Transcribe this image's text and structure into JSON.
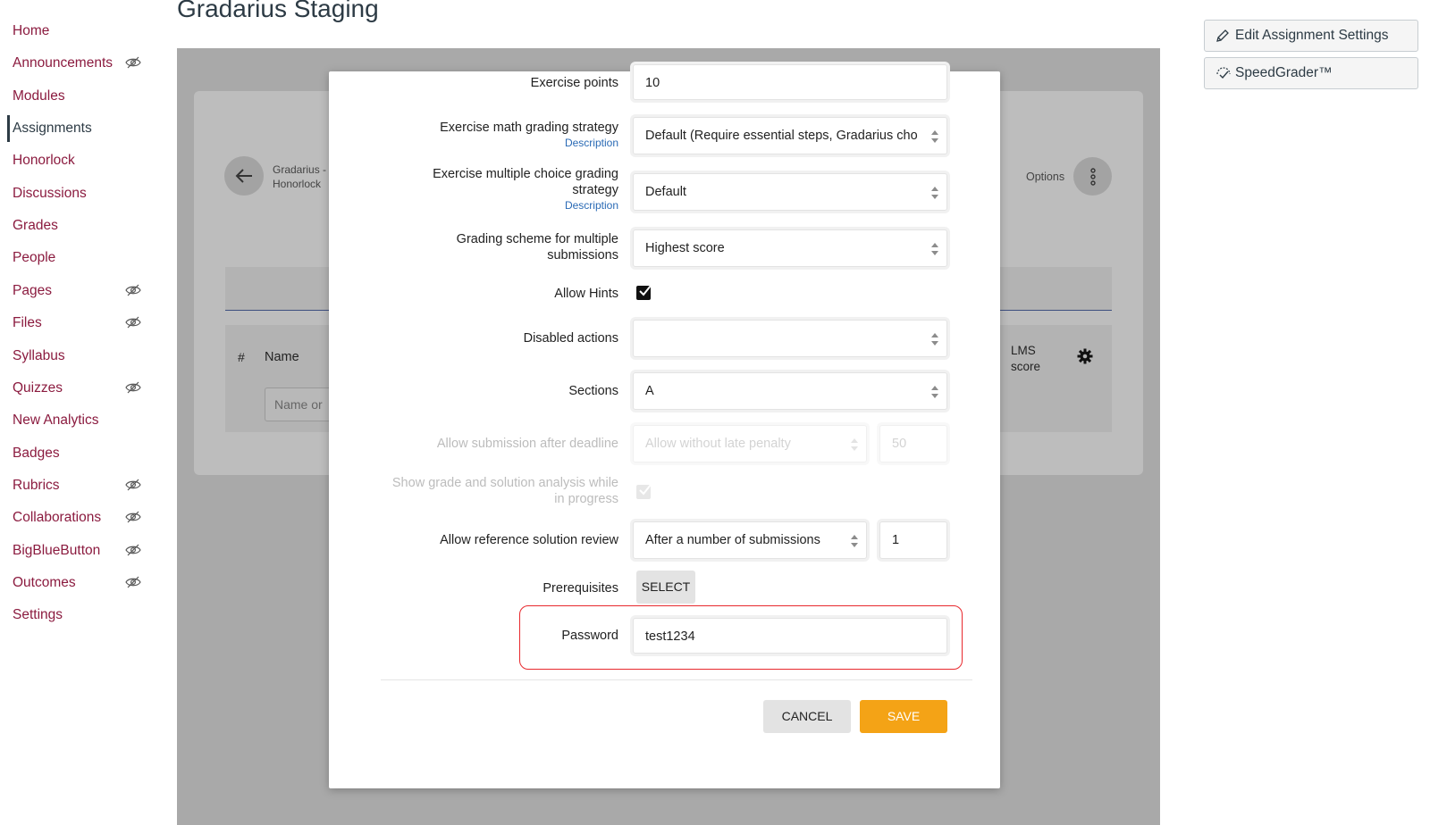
{
  "page_title": "Gradarius Staging",
  "course_nav": [
    {
      "label": "Home",
      "hidden": false
    },
    {
      "label": "Announcements",
      "hidden": true
    },
    {
      "label": "Modules",
      "hidden": false
    },
    {
      "label": "Assignments",
      "hidden": false,
      "active": true
    },
    {
      "label": "Honorlock",
      "hidden": false
    },
    {
      "label": "Discussions",
      "hidden": false
    },
    {
      "label": "Grades",
      "hidden": false
    },
    {
      "label": "People",
      "hidden": false
    },
    {
      "label": "Pages",
      "hidden": true
    },
    {
      "label": "Files",
      "hidden": true
    },
    {
      "label": "Syllabus",
      "hidden": false
    },
    {
      "label": "Quizzes",
      "hidden": true
    },
    {
      "label": "New Analytics",
      "hidden": false
    },
    {
      "label": "Badges",
      "hidden": false
    },
    {
      "label": "Rubrics",
      "hidden": true
    },
    {
      "label": "Collaborations",
      "hidden": true
    },
    {
      "label": "BigBlueButton",
      "hidden": true
    },
    {
      "label": "Outcomes",
      "hidden": true
    },
    {
      "label": "Settings",
      "hidden": false
    }
  ],
  "right_actions": {
    "edit_settings": "Edit Assignment Settings",
    "speedgrader": "SpeedGrader™"
  },
  "background": {
    "breadcrumb_line1": "Gradarius -",
    "breadcrumb_line2": "Honorlock",
    "options_label": "Options",
    "table_hash": "#",
    "table_name": "Name",
    "search_placeholder": "Name or",
    "lms_score": "LMS score"
  },
  "modal": {
    "exercise_points_label": "Exercise points",
    "exercise_points_value": "10",
    "math_strategy_label": "Exercise math grading strategy",
    "math_strategy_desc": "Description",
    "math_strategy_value": "Default (Require essential steps, Gradarius cho",
    "mc_strategy_label_1": "Exercise multiple choice grading",
    "mc_strategy_label_2": "strategy",
    "mc_strategy_desc": "Description",
    "mc_strategy_value": "Default",
    "scheme_label_1": "Grading scheme for multiple",
    "scheme_label_2": "submissions",
    "scheme_value": "Highest score",
    "allow_hints_label": "Allow Hints",
    "allow_hints_checked": true,
    "disabled_actions_label": "Disabled actions",
    "disabled_actions_value": "",
    "sections_label": "Sections",
    "sections_value": "A",
    "after_deadline_label": "Allow submission after deadline",
    "after_deadline_value": "Allow without late penalty",
    "after_deadline_number": "50",
    "show_grade_label_1": "Show grade and solution analysis while",
    "show_grade_label_2": "in progress",
    "show_grade_checked": true,
    "ref_review_label": "Allow reference solution review",
    "ref_review_value": "After a number of submissions",
    "ref_review_number": "1",
    "prerequisites_label": "Prerequisites",
    "select_button": "SELECT",
    "password_label": "Password",
    "password_value": "test1234",
    "cancel_button": "CANCEL",
    "save_button": "SAVE"
  },
  "colors": {
    "nav_link": "#8b1b3f",
    "save_button": "#f4a316",
    "highlight_box": "#e8282d",
    "description_link": "#2a6ab5"
  }
}
